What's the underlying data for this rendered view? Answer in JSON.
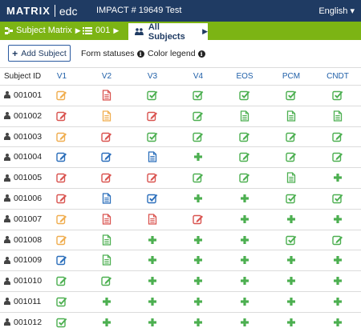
{
  "header": {
    "logo_main": "MATRIX",
    "logo_sub": "edc",
    "study": "IMPACT # 19649 Test",
    "language": "English",
    "language_caret": "▾"
  },
  "breadcrumb": {
    "items": [
      {
        "label": "Subject Matrix",
        "icon": "sitemap-icon"
      },
      {
        "label": "001",
        "icon": "list-icon"
      }
    ],
    "active": {
      "label": "All Subjects",
      "icon": "users-icon"
    },
    "arrow": "▶"
  },
  "toolbar": {
    "add_label": "Add Subject",
    "add_icon": "+",
    "form_statuses": "Form statuses",
    "color_legend": "Color legend",
    "info_glyph": "i"
  },
  "colors": {
    "header_bg": "#1f3b63",
    "breadcrumb_bg": "#7cb414",
    "green": "#4caf50",
    "red": "#d9534f",
    "orange": "#f0ad4e",
    "blue": "#2a6ebb"
  },
  "table": {
    "subject_header": "Subject ID",
    "columns": [
      "V1",
      "V2",
      "V3",
      "V4",
      "EOS",
      "PCM",
      "CNDT"
    ],
    "rows": [
      {
        "id": "001001",
        "cells": [
          "edit-orange",
          "doc-red",
          "check-green",
          "check-green",
          "check-green",
          "check-green",
          "check-green"
        ]
      },
      {
        "id": "001002",
        "cells": [
          "edit-red",
          "doc-orange",
          "edit-red",
          "edit-green",
          "doc-green",
          "doc-green",
          "doc-green"
        ]
      },
      {
        "id": "001003",
        "cells": [
          "edit-orange",
          "edit-red",
          "check-green",
          "edit-green",
          "edit-green",
          "edit-green",
          "edit-green"
        ]
      },
      {
        "id": "001004",
        "cells": [
          "edit-blue",
          "edit-blue",
          "doc-blue",
          "plus-green",
          "edit-green",
          "edit-green",
          "edit-green"
        ]
      },
      {
        "id": "001005",
        "cells": [
          "edit-red",
          "edit-red",
          "edit-red",
          "edit-green",
          "edit-green",
          "doc-green",
          "plus-green"
        ]
      },
      {
        "id": "001006",
        "cells": [
          "edit-red",
          "doc-blue",
          "check-blue",
          "plus-green",
          "plus-green",
          "check-green",
          "check-green"
        ]
      },
      {
        "id": "001007",
        "cells": [
          "edit-orange",
          "doc-red",
          "doc-red",
          "edit-red",
          "plus-green",
          "plus-green",
          "plus-green"
        ]
      },
      {
        "id": "001008",
        "cells": [
          "edit-orange",
          "doc-green",
          "plus-green",
          "plus-green",
          "plus-green",
          "check-green",
          "edit-green"
        ]
      },
      {
        "id": "001009",
        "cells": [
          "edit-blue",
          "doc-green",
          "plus-green",
          "plus-green",
          "plus-green",
          "plus-green",
          "plus-green"
        ]
      },
      {
        "id": "001010",
        "cells": [
          "edit-green",
          "edit-green",
          "plus-green",
          "plus-green",
          "plus-green",
          "plus-green",
          "plus-green"
        ]
      },
      {
        "id": "001011",
        "cells": [
          "check-green",
          "plus-green",
          "plus-green",
          "plus-green",
          "plus-green",
          "plus-green",
          "plus-green"
        ]
      },
      {
        "id": "001012",
        "cells": [
          "check-green",
          "plus-green",
          "plus-green",
          "plus-green",
          "plus-green",
          "plus-green",
          "plus-green"
        ]
      }
    ]
  }
}
